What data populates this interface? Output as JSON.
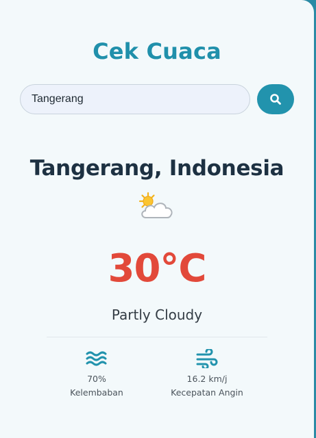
{
  "app": {
    "title": "Cek Cuaca"
  },
  "search": {
    "value": "Tangerang",
    "button_icon": "search-icon"
  },
  "weather": {
    "location": "Tangerang, Indonesia",
    "icon": "partly-cloudy-icon",
    "temperature": "30°C",
    "condition": "Partly Cloudy"
  },
  "details": [
    {
      "icon": "humidity-icon",
      "value": "70%",
      "label": "Kelembaban"
    },
    {
      "icon": "wind-icon",
      "value": "16.2 km/j",
      "label": "Kecepatan Angin"
    }
  ],
  "colors": {
    "accent": "#2293ad",
    "temperature": "#e2493a",
    "heading": "#1d3142",
    "background": "#f3f9fb"
  }
}
